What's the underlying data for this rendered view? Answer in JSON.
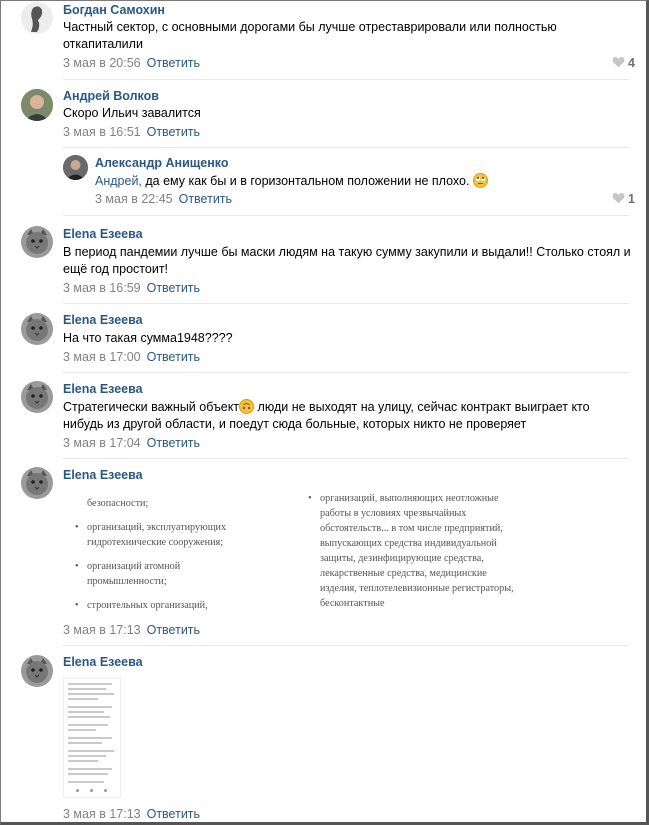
{
  "comments": [
    {
      "author": "Богдан Самохин",
      "text": "Частный сектор, с основными дорогами бы лучше отреставрировали или полностью откапиталили",
      "time": "3 мая в 20:56",
      "reply": "Ответить",
      "likes": "4"
    },
    {
      "author": "Андрей Волков",
      "text": "Скоро Ильич завалится",
      "time": "3 мая в 16:51",
      "reply": "Ответить"
    },
    {
      "author": "Александр Анищенко",
      "mention": "Андрей,",
      "text": "да ему как бы и в горизонтальном положении не плохо.",
      "time": "3 мая в 22:45",
      "reply": "Ответить",
      "likes": "1"
    },
    {
      "author": "Elena Езеева",
      "text": "В период пандемии лучше бы маски людям на такую сумму закупили и выдали!! Столько стоял и ещё год простоит!",
      "time": "3 мая в 16:59",
      "reply": "Ответить"
    },
    {
      "author": "Elena Езеева",
      "text": "На что такая сумма1948????",
      "time": "3 мая в 17:00",
      "reply": "Ответить"
    },
    {
      "author": "Elena Езеева",
      "text_a": "Стратегически важный объект",
      "text_b": "люди не выходят на улицу, сейчас контракт выиграет кто нибудь из другой области, и поедут сюда больные, которых никто не проверяет",
      "time": "3 мая в 17:04",
      "reply": "Ответить"
    },
    {
      "author": "Elena Езеева",
      "time": "3 мая в 17:13",
      "reply": "Ответить",
      "doc_left": [
        "безопасности;",
        "организаций, эксплуатирующих гидротехнические сооружения;",
        "организаций атомной промышленности;",
        "строительных организаций,"
      ],
      "doc_right": "организаций, выполняющих неотложные работы в условиях чрезвычайных обстоятельств... в том числе предприятий, выпускающих средства индивидуальной защиты, дезинфицирующие средства, лекарственные средства, медицинские изделия, теплотелевизионные регистраторы, бесконтактные"
    },
    {
      "author": "Elena Езеева",
      "time": "3 мая в 17:13",
      "reply": "Ответить"
    }
  ],
  "icons": {
    "heart": "heart-icon",
    "emoji_rolling_eyes": "rolling-eyes-emoji",
    "emoji_upside_down": "upside-down-face-emoji"
  },
  "colors": {
    "link": "#2a5885",
    "meta": "#828282",
    "separator": "#e7e8ec"
  }
}
